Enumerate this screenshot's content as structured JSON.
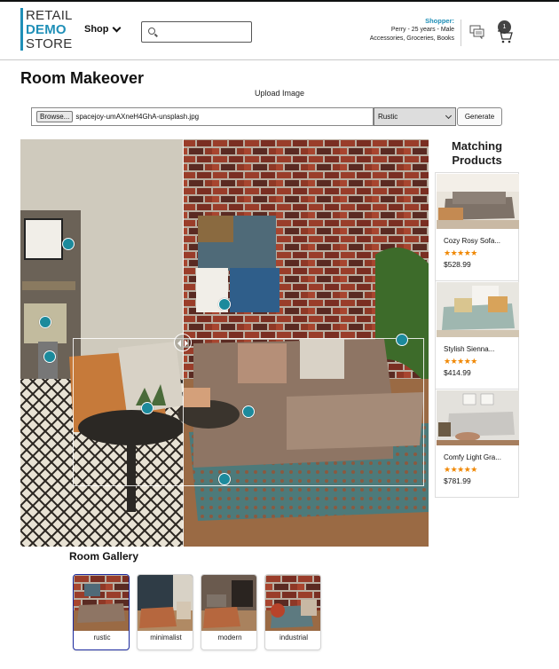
{
  "header": {
    "logo": {
      "line1": "RETAIL",
      "line2": "DEMO",
      "line3": "STORE"
    },
    "shop_label": "Shop",
    "search": {
      "placeholder": "",
      "value": ""
    },
    "shopper": {
      "title": "Shopper:",
      "line1": "Perry - 25 years - Male",
      "line2": "Accessories, Groceries, Books"
    },
    "cart_count": "1",
    "icons": [
      "chevron-down-icon",
      "search-icon",
      "chat-icon",
      "cart-icon"
    ]
  },
  "main": {
    "title": "Room Makeover",
    "upload_label": "Upload Image",
    "browse_label": "Browse...",
    "file_name": "spacejoy-umAXneH4GhA-unsplash.jpg",
    "style_select": {
      "selected": "Rustic"
    },
    "generate_label": "Generate"
  },
  "matching": {
    "title": "Matching Products",
    "products": [
      {
        "name": "Cozy Rosy Sofa...",
        "rating": 5,
        "stars": "★★★★★",
        "price": "$528.99"
      },
      {
        "name": "Stylish Sienna...",
        "rating": 5,
        "stars": "★★★★★",
        "price": "$414.99"
      },
      {
        "name": "Comfy Light Gra...",
        "rating": 5,
        "stars": "★★★★★",
        "price": "$781.99"
      }
    ]
  },
  "gallery": {
    "title": "Room Gallery",
    "items": [
      {
        "label": "rustic",
        "active": true
      },
      {
        "label": "minimalist",
        "active": false
      },
      {
        "label": "modern",
        "active": false
      },
      {
        "label": "industrial",
        "active": false
      }
    ]
  },
  "colors": {
    "accent": "#1f8fb7",
    "hotspot": "#1c8a9c",
    "star": "#f08804",
    "gallery_active": "#1d2ba0"
  }
}
